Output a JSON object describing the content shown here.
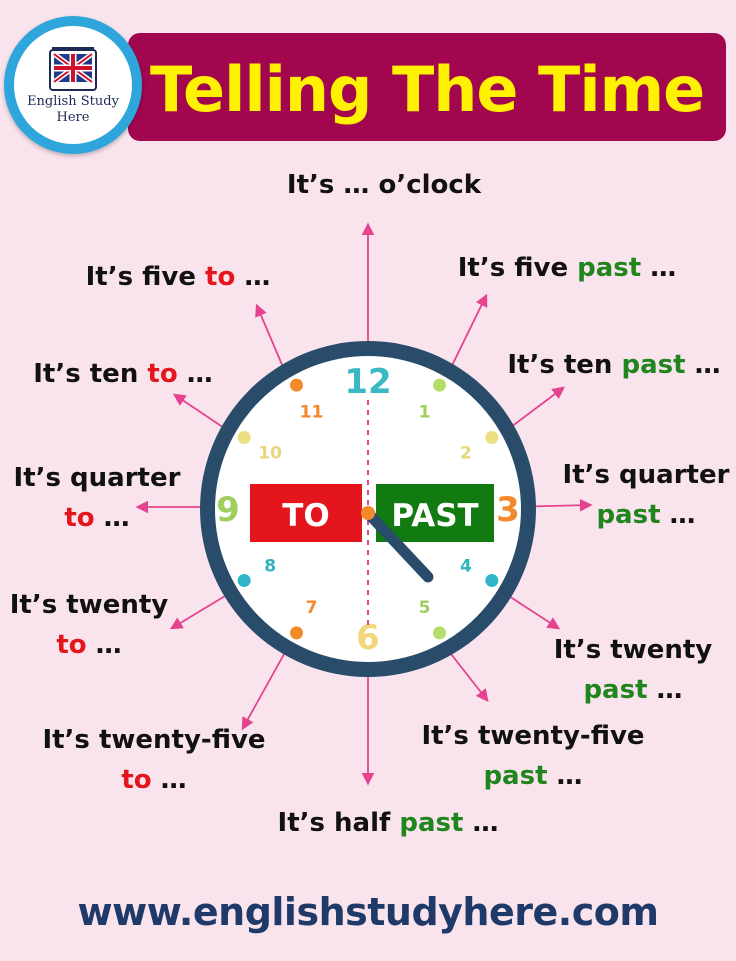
{
  "header": {
    "title": "Telling The Time",
    "logo_line1": "English Study",
    "logo_line2": "Here"
  },
  "clock": {
    "numbers": [
      "12",
      "1",
      "2",
      "3",
      "4",
      "5",
      "6",
      "7",
      "8",
      "9",
      "10",
      "11"
    ],
    "to_label": "TO",
    "past_label": "PAST"
  },
  "phrases": [
    {
      "name": "oclock",
      "lines": [
        [
          {
            "t": "It’s … o’clock"
          }
        ]
      ]
    },
    {
      "name": "five-past",
      "lines": [
        [
          {
            "t": "It’s five "
          },
          {
            "t": "past",
            "c": "past"
          },
          {
            "t": " …"
          }
        ]
      ]
    },
    {
      "name": "ten-past",
      "lines": [
        [
          {
            "t": "It’s ten "
          },
          {
            "t": "past",
            "c": "past"
          },
          {
            "t": " …"
          }
        ]
      ]
    },
    {
      "name": "quarter-past",
      "lines": [
        [
          {
            "t": "It’s quarter"
          }
        ],
        [
          {
            "t": "past",
            "c": "past"
          },
          {
            "t": " …"
          }
        ]
      ]
    },
    {
      "name": "twenty-past",
      "lines": [
        [
          {
            "t": "It’s twenty"
          }
        ],
        [
          {
            "t": "past",
            "c": "past"
          },
          {
            "t": " …"
          }
        ]
      ]
    },
    {
      "name": "twenty-five-past",
      "lines": [
        [
          {
            "t": "It’s twenty-five"
          }
        ],
        [
          {
            "t": "past",
            "c": "past"
          },
          {
            "t": " …"
          }
        ]
      ]
    },
    {
      "name": "half-past",
      "lines": [
        [
          {
            "t": "It’s half "
          },
          {
            "t": "past",
            "c": "past"
          },
          {
            "t": " …"
          }
        ]
      ]
    },
    {
      "name": "twenty-five-to",
      "lines": [
        [
          {
            "t": "It’s twenty-five"
          }
        ],
        [
          {
            "t": "to",
            "c": "to"
          },
          {
            "t": " …"
          }
        ]
      ]
    },
    {
      "name": "twenty-to",
      "lines": [
        [
          {
            "t": "It’s twenty"
          }
        ],
        [
          {
            "t": "to",
            "c": "to"
          },
          {
            "t": " …"
          }
        ]
      ]
    },
    {
      "name": "quarter-to",
      "lines": [
        [
          {
            "t": "It’s quarter"
          }
        ],
        [
          {
            "t": "to",
            "c": "to"
          },
          {
            "t": " …"
          }
        ]
      ]
    },
    {
      "name": "ten-to",
      "lines": [
        [
          {
            "t": "It’s ten "
          },
          {
            "t": "to",
            "c": "to"
          },
          {
            "t": " …"
          }
        ]
      ]
    },
    {
      "name": "five-to",
      "lines": [
        [
          {
            "t": "It’s five "
          },
          {
            "t": "to",
            "c": "to"
          },
          {
            "t": " …"
          }
        ]
      ]
    }
  ],
  "footer": {
    "website": "www.englishstudyhere.com"
  },
  "colors": {
    "background": "#f9e4ee",
    "title_bar": "#a1064f",
    "title_text": "#fff200",
    "clock_ring": "#294c6b",
    "arrow": "#e5438f",
    "to_red": "#e4151c",
    "past_green": "#21851e",
    "text_dark": "#111111",
    "website_blue": "#1f3a68"
  }
}
